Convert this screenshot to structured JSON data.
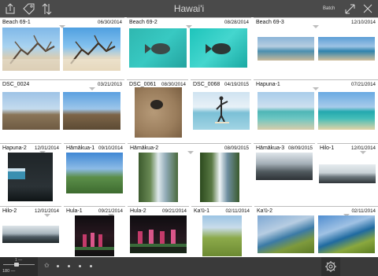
{
  "header": {
    "title": "Hawai'i",
    "batch_label": "Batch"
  },
  "rows": [
    [
      {
        "name": "Beach 69-1",
        "date": "06/30/2014"
      },
      {
        "name": "Beach 69-2",
        "date": "08/28/2014"
      },
      {
        "name": "Beach 69-3",
        "date": "12/10/2014"
      }
    ],
    [
      {
        "name": "DSC_0024",
        "date": "03/21/2013"
      },
      {
        "name": "DSC_0061",
        "date": "08/30/2014"
      },
      {
        "name": "DSC_0068",
        "date": "04/19/2015"
      },
      {
        "name": "Hapuna-1",
        "date": "07/21/2014"
      }
    ],
    [
      {
        "name": "Hapuna-2",
        "date": "12/01/2014"
      },
      {
        "name": "Hāmākua-1",
        "date": "09/10/2014"
      },
      {
        "name": "Hāmākua-2",
        "date": "08/09/2015"
      },
      {
        "name": "Hāmākua-3",
        "date": "08/09/2015"
      },
      {
        "name": "Hilo-1",
        "date": "12/01/2014"
      }
    ],
    [
      {
        "name": "Hilo-2",
        "date": "12/01/2014"
      },
      {
        "name": "Hula-1",
        "date": "09/21/2014"
      },
      {
        "name": "Hula-2",
        "date": "09/21/2014"
      },
      {
        "name": "Ka'ū-1",
        "date": "02/11/2014"
      },
      {
        "name": "Ka'ū-2",
        "date": "02/11/2014"
      }
    ]
  ],
  "footer": {
    "zoom_label": "180 —",
    "zoom_tick": "1 —"
  },
  "icons": {
    "share": "share-icon",
    "tag": "tag-icon",
    "sort": "sort-arrows-icon",
    "expand": "expand-icon",
    "close": "close-icon",
    "star": "star-icon",
    "settings": "gear-icon"
  },
  "colors": {
    "toolbar": "#4a4a4a",
    "bottombar": "#3a3a3a",
    "divider": "#bdbdbd"
  }
}
